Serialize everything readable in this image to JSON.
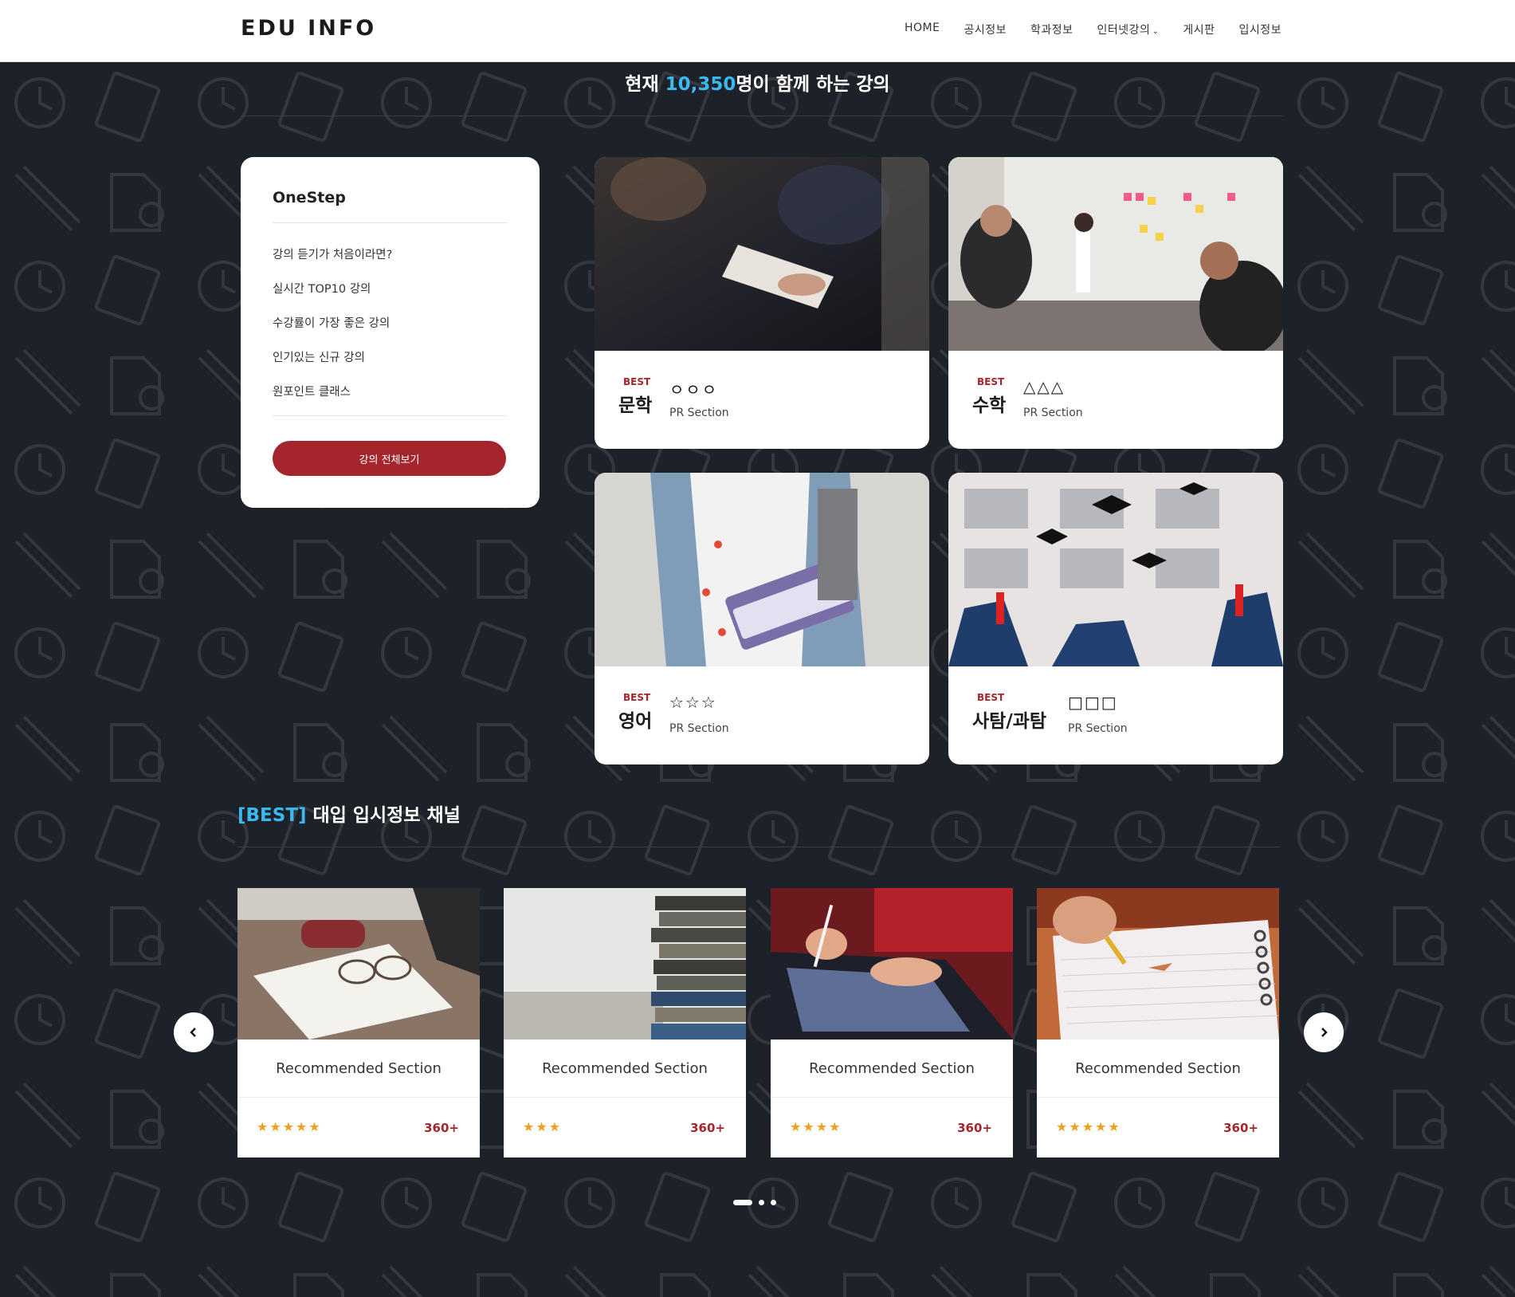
{
  "header": {
    "logo": "EDU INFO",
    "nav": [
      {
        "label": "HOME"
      },
      {
        "label": "공시정보"
      },
      {
        "label": "학과정보"
      },
      {
        "label": "인터넷강의"
      },
      {
        "label": "게시판"
      },
      {
        "label": "입시정보"
      }
    ]
  },
  "hero": {
    "prefix": "현재 ",
    "count": "10,350",
    "suffix": "명이 함께 하는 강의"
  },
  "onestep": {
    "title": "OneStep",
    "items": [
      "강의 듣기가 처음이라면?",
      "실시간 TOP10 강의",
      "수강률이 가장 좋은 강의",
      "인기있는 신규 강의",
      "원포인트 클래스"
    ],
    "button": "강의 전체보기"
  },
  "courses": [
    {
      "badge": "BEST",
      "subject": "문학",
      "symbol": "ㅇㅇㅇ",
      "caption": "PR Section"
    },
    {
      "badge": "BEST",
      "subject": "수학",
      "symbol": "△△△",
      "caption": "PR Section"
    },
    {
      "badge": "BEST",
      "subject": "영어",
      "symbol": "☆☆☆",
      "caption": "PR Section"
    },
    {
      "badge": "BEST",
      "subject": "사탐/과탐",
      "symbol": "□□□",
      "caption": "PR Section"
    }
  ],
  "channel": {
    "tag": "[BEST]",
    "title": " 대입 입시정보 채널",
    "cards": [
      {
        "label": "Recommended Section",
        "stars": "★★★★★",
        "rating": 5,
        "count": "360+"
      },
      {
        "label": "Recommended Section",
        "stars": "★★★",
        "rating": 3,
        "count": "360+"
      },
      {
        "label": "Recommended Section",
        "stars": "★★★★",
        "rating": 4,
        "count": "360+"
      },
      {
        "label": "Recommended Section",
        "stars": "★★★★★",
        "rating": 5,
        "count": "360+"
      }
    ],
    "carousel": {
      "pages": 3,
      "active": 1
    }
  },
  "colors": {
    "background": "#1d2128",
    "accent": "#a4262c",
    "highlight": "#3ab8f0",
    "star": "#e9a21a"
  }
}
